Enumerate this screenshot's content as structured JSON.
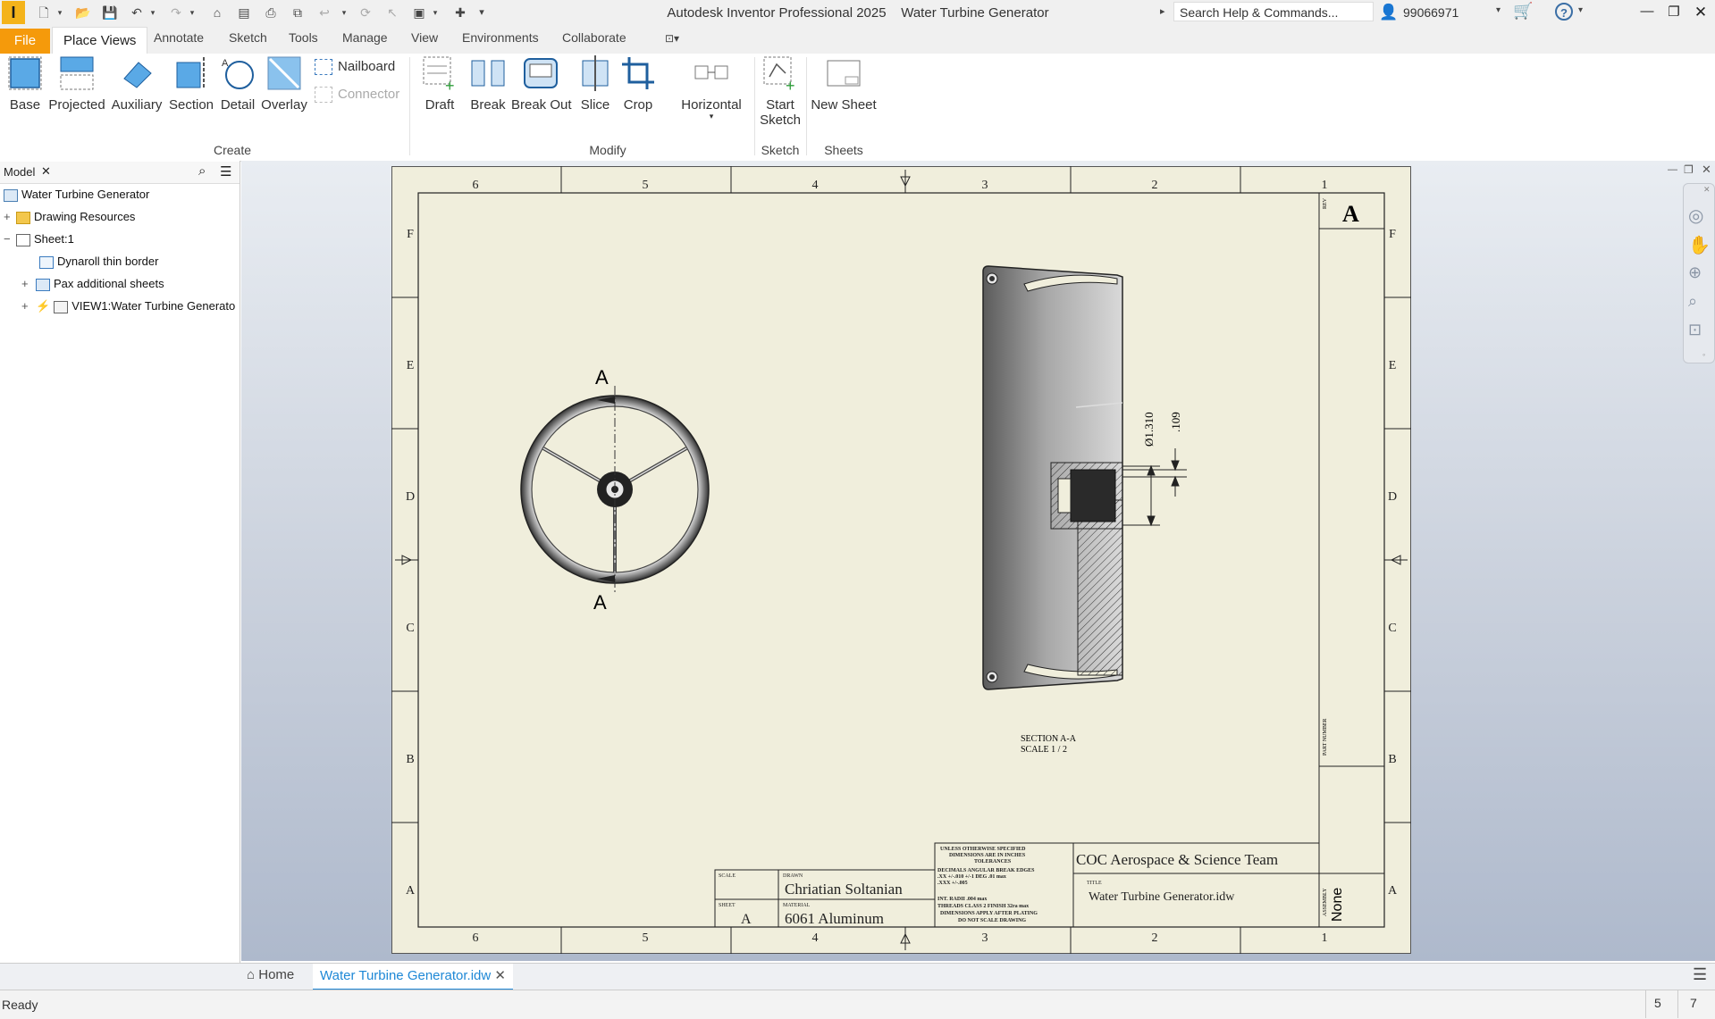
{
  "app": {
    "title": "Autodesk Inventor Professional 2025",
    "document": "Water Turbine Generator",
    "search_placeholder": "Search Help & Commands...",
    "user": "99066971"
  },
  "ribbon": {
    "tabs": [
      "File",
      "Place Views",
      "Annotate",
      "Sketch",
      "Tools",
      "Manage",
      "View",
      "Environments",
      "Collaborate"
    ],
    "active_tab": "Place Views",
    "create": {
      "group_label": "Create",
      "buttons": [
        "Base",
        "Projected",
        "Auxiliary",
        "Section",
        "Detail",
        "Overlay"
      ],
      "small_buttons": [
        "Nailboard",
        "Connector"
      ]
    },
    "modify": {
      "group_label": "Modify",
      "buttons": [
        "Draft",
        "Break",
        "Break Out",
        "Slice",
        "Crop",
        "Horizontal"
      ]
    },
    "sketch": {
      "group_label": "Sketch",
      "button_line1": "Start",
      "button_line2": "Sketch"
    },
    "sheets": {
      "group_label": "Sheets",
      "button": "New Sheet"
    }
  },
  "browser": {
    "tab_label": "Model",
    "items": [
      {
        "label": "Water Turbine Generator"
      },
      {
        "label": "Drawing Resources"
      },
      {
        "label": "Sheet:1"
      },
      {
        "label": "Dynaroll thin border"
      },
      {
        "label": "Pax additional sheets"
      },
      {
        "label": "VIEW1:Water Turbine Generato"
      }
    ]
  },
  "drawing": {
    "zone_columns": [
      "6",
      "5",
      "4",
      "3",
      "2",
      "1"
    ],
    "zone_rows": [
      "F",
      "E",
      "D",
      "C",
      "B",
      "A"
    ],
    "section_marker": "A",
    "section_caption_1": "SECTION A-A",
    "section_caption_2": "SCALE 1 / 2",
    "dim_diameter": "Ø1.310",
    "dim_depth": ".109",
    "rev_label": "REV",
    "rev_value": "A",
    "part_number_label": "PART NUMBER",
    "title_block": {
      "scale_label": "SCALE",
      "drawn_label": "DRAWN",
      "drawn_value": "Chriatian Soltanian",
      "sheet_label": "SHEET",
      "sheet_value": "A",
      "material_label": "MATERIAL",
      "material_value": "6061 Aluminum",
      "notes": [
        "UNLESS OTHERWISE SPECIFIED",
        "DIMENSIONS ARE IN INCHES",
        "TOLERANCES",
        "DECIMALS   ANGULAR   BREAK EDGES",
        ".XX +/-.010    +/-1 DEG     .01  max",
        ".XXX +/-.005",
        "INT. RADII .004 max",
        "THREADS CLASS 2        FINISH 32ra max",
        "DIMENSIONS APPLY AFTER PLATING",
        "DO NOT SCALE DRAWING"
      ],
      "company": "COC Aerospace & Science Team",
      "title_label": "TITLE",
      "title_value": "Water Turbine Generator.idw",
      "assembly_label": "ASSEMBLY",
      "assembly_value": "None"
    }
  },
  "doc_tabs": {
    "home": "Home",
    "active": "Water Turbine Generator.idw"
  },
  "status": {
    "text": "Ready",
    "num1": "5",
    "num2": "7"
  },
  "colors": {
    "file_tab": "#f59a0b",
    "sheet": "#f0eedc",
    "accent": "#1e88d6"
  }
}
